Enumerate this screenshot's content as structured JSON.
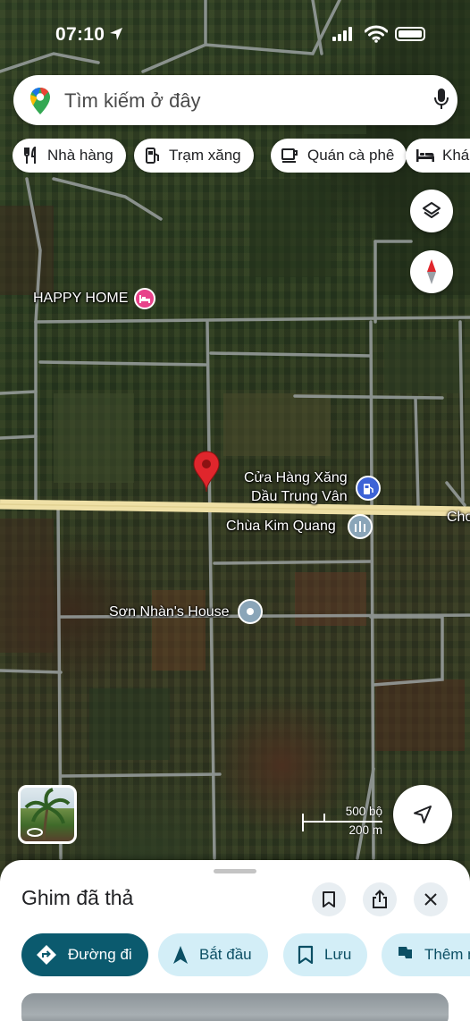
{
  "status_bar": {
    "time": "07:10"
  },
  "search": {
    "placeholder": "Tìm kiếm ở đây"
  },
  "chips": [
    {
      "label": "Nhà hàng",
      "icon": "fork-knife-icon"
    },
    {
      "label": "Trạm xăng",
      "icon": "gas-station-icon"
    },
    {
      "label": "Quán cà phê",
      "icon": "coffee-cup-icon"
    },
    {
      "label": "Khách sạn",
      "icon": "bed-icon"
    }
  ],
  "map": {
    "labels": {
      "happy_home": "HAPPY HOME",
      "gas_station_line1": "Cửa Hàng Xăng",
      "gas_station_line2": "Dầu Trung Vân",
      "pagoda": "Chùa Kim Quang",
      "house": "Sơn Nhàn's House",
      "road_edge": "Cho"
    },
    "scale": {
      "top": "500 bộ",
      "bottom": "200 m"
    },
    "colors": {
      "hotel_pin": "#e8428a",
      "gas_pin": "#3d63d6",
      "pagoda_pin": "#8aa5b8",
      "dropped_pin": "#e0262c"
    }
  },
  "sheet": {
    "title": "Ghim đã thả",
    "actions": [
      {
        "label": "Đường đi",
        "icon": "directions-icon"
      },
      {
        "label": "Bắt đầu",
        "icon": "navigation-arrow-icon"
      },
      {
        "label": "Lưu",
        "icon": "bookmark-icon"
      },
      {
        "label": "Thêm nhãn",
        "icon": "flag-icon"
      }
    ]
  }
}
